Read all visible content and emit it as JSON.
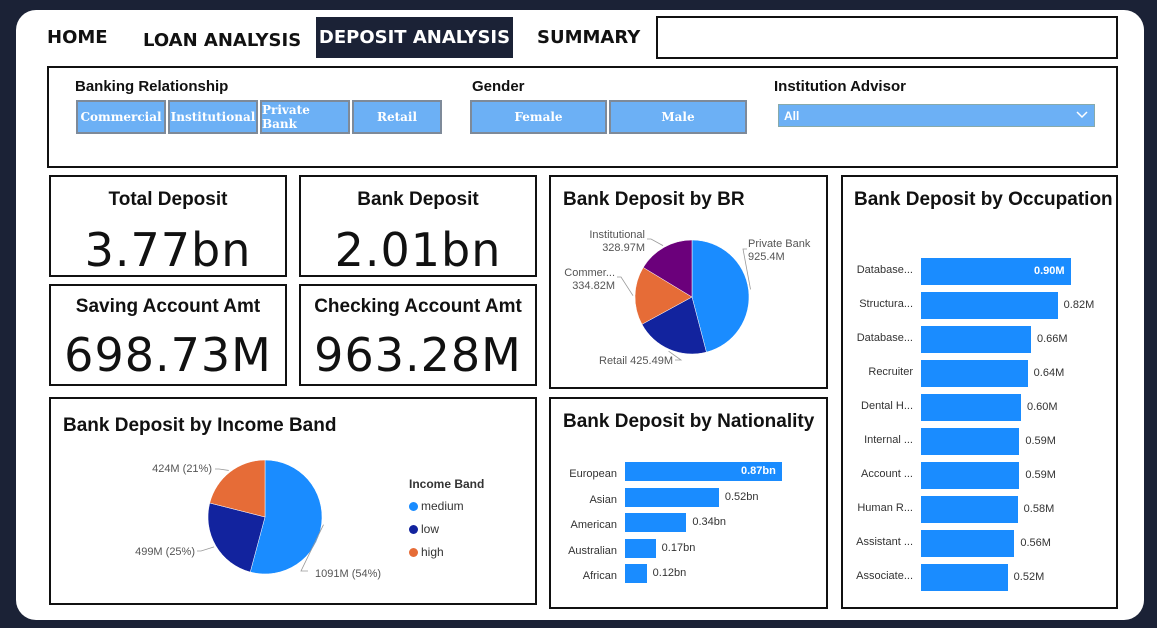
{
  "nav": {
    "home": "HOME",
    "loan": "LOAN ANALYSIS",
    "deposit": "DEPOSIT ANALYSIS",
    "summary": "SUMMARY"
  },
  "filters": {
    "banking_relationship": {
      "label": "Banking Relationship",
      "options": [
        "Commercial",
        "Institutional",
        "Private Bank",
        "Retail"
      ]
    },
    "gender": {
      "label": "Gender",
      "options": [
        "Female",
        "Male"
      ]
    },
    "advisor": {
      "label": "Institution Advisor",
      "selected": "All"
    }
  },
  "kpis": {
    "total_deposit": {
      "title": "Total Deposit",
      "value": "3.77bn"
    },
    "bank_deposit": {
      "title": "Bank Deposit",
      "value": "2.01bn"
    },
    "saving": {
      "title": "Saving Account Amt",
      "value": "698.73M"
    },
    "checking": {
      "title": "Checking Account Amt",
      "value": "963.28M"
    }
  },
  "colors": {
    "accent_blue": "#1a8cff",
    "dark_navy": "#12239e",
    "orange": "#e66c37",
    "purple": "#6b007b",
    "button_blue": "#6cb0f5"
  },
  "chart_data": [
    {
      "type": "pie",
      "title": "Bank Deposit by BR",
      "categories": [
        "Private Bank",
        "Retail",
        "Commer...",
        "Institutional"
      ],
      "values": [
        925.4,
        425.49,
        334.82,
        328.97
      ],
      "labels": [
        "925.4M",
        "425.49M",
        "334.82M",
        "328.97M"
      ]
    },
    {
      "type": "bar",
      "title": "Bank Deposit by Occupation",
      "categories": [
        "Database...",
        "Structura...",
        "Database...",
        "Recruiter",
        "Dental H...",
        "Internal ...",
        "Account ...",
        "Human R...",
        "Assistant ...",
        "Associate..."
      ],
      "values": [
        0.9,
        0.82,
        0.66,
        0.64,
        0.6,
        0.59,
        0.59,
        0.58,
        0.56,
        0.52
      ],
      "labels": [
        "0.90M",
        "0.82M",
        "0.66M",
        "0.64M",
        "0.60M",
        "0.59M",
        "0.59M",
        "0.58M",
        "0.56M",
        "0.52M"
      ]
    },
    {
      "type": "pie",
      "title": "Bank Deposit by Income Band",
      "legend_title": "Income Band",
      "categories": [
        "medium",
        "low",
        "high"
      ],
      "values": [
        1091,
        499,
        424
      ],
      "labels": [
        "1091M (54%)",
        "499M (25%)",
        "424M (21%)"
      ]
    },
    {
      "type": "bar",
      "title": "Bank Deposit by Nationality",
      "categories": [
        "European",
        "Asian",
        "American",
        "Australian",
        "African"
      ],
      "values": [
        0.87,
        0.52,
        0.34,
        0.17,
        0.12
      ],
      "labels": [
        "0.87bn",
        "0.52bn",
        "0.34bn",
        "0.17bn",
        "0.12bn"
      ]
    }
  ]
}
